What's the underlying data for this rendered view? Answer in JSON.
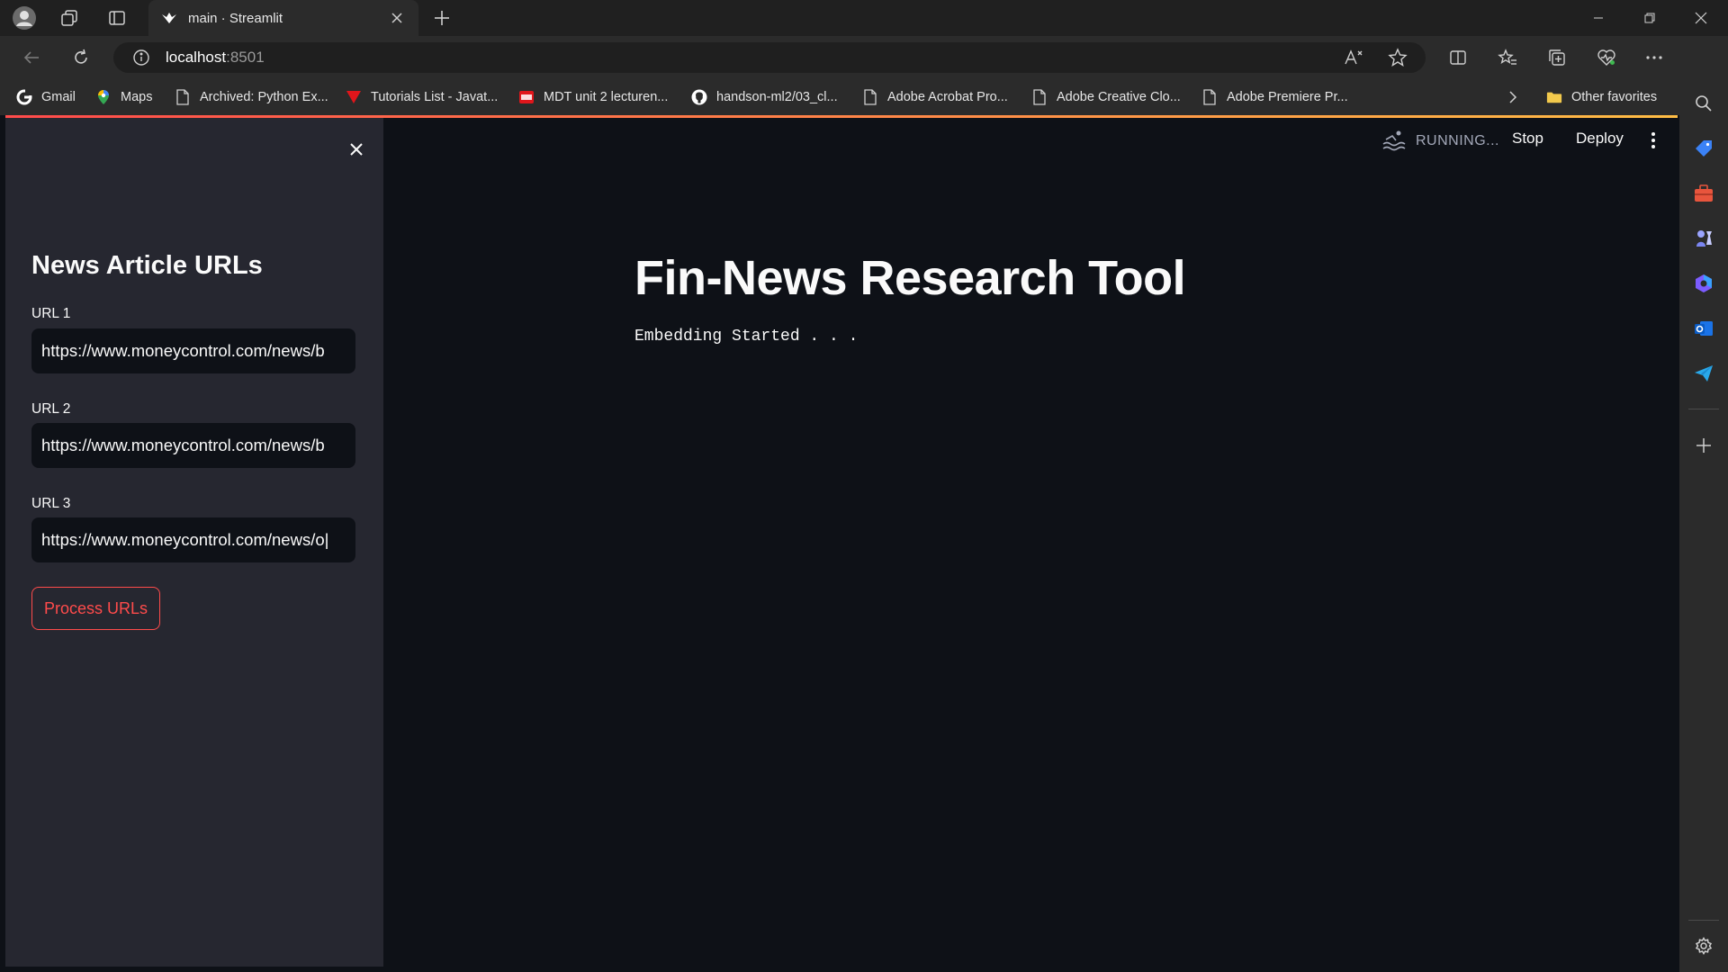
{
  "browser": {
    "tab_title": "main · Streamlit",
    "url_host": "localhost",
    "url_port": ":8501",
    "favorites": [
      {
        "label": "Gmail",
        "icon": "google-icon"
      },
      {
        "label": "Maps",
        "icon": "maps-icon"
      },
      {
        "label": "Archived: Python Ex...",
        "icon": "page-icon"
      },
      {
        "label": "Tutorials List - Javat...",
        "icon": "javatpoint-icon"
      },
      {
        "label": "MDT unit 2 lecturen...",
        "icon": "pdf-icon"
      },
      {
        "label": "handson-ml2/03_cl...",
        "icon": "github-icon"
      },
      {
        "label": "Adobe Acrobat Pro...",
        "icon": "page-icon"
      },
      {
        "label": "Adobe Creative Clo...",
        "icon": "page-icon"
      },
      {
        "label": "Adobe Premiere Pr...",
        "icon": "page-icon"
      }
    ],
    "other_favorites": "Other favorites"
  },
  "app": {
    "status": "RUNNING...",
    "stop_label": "Stop",
    "deploy_label": "Deploy",
    "title": "Fin-News Research Tool",
    "status_text": "Embedding Started . . ."
  },
  "sidebar": {
    "title": "News Article URLs",
    "url1_label": "URL 1",
    "url1_value": "https://www.moneycontrol.com/news/b",
    "url2_label": "URL 2",
    "url2_value": "https://www.moneycontrol.com/news/b",
    "url3_label": "URL 3",
    "url3_value": "https://www.moneycontrol.com/news/o|",
    "process_label": "Process URLs"
  },
  "colors": {
    "accent": "#ff4b4b",
    "sidebar_bg": "#262730",
    "main_bg": "#0e1117"
  }
}
